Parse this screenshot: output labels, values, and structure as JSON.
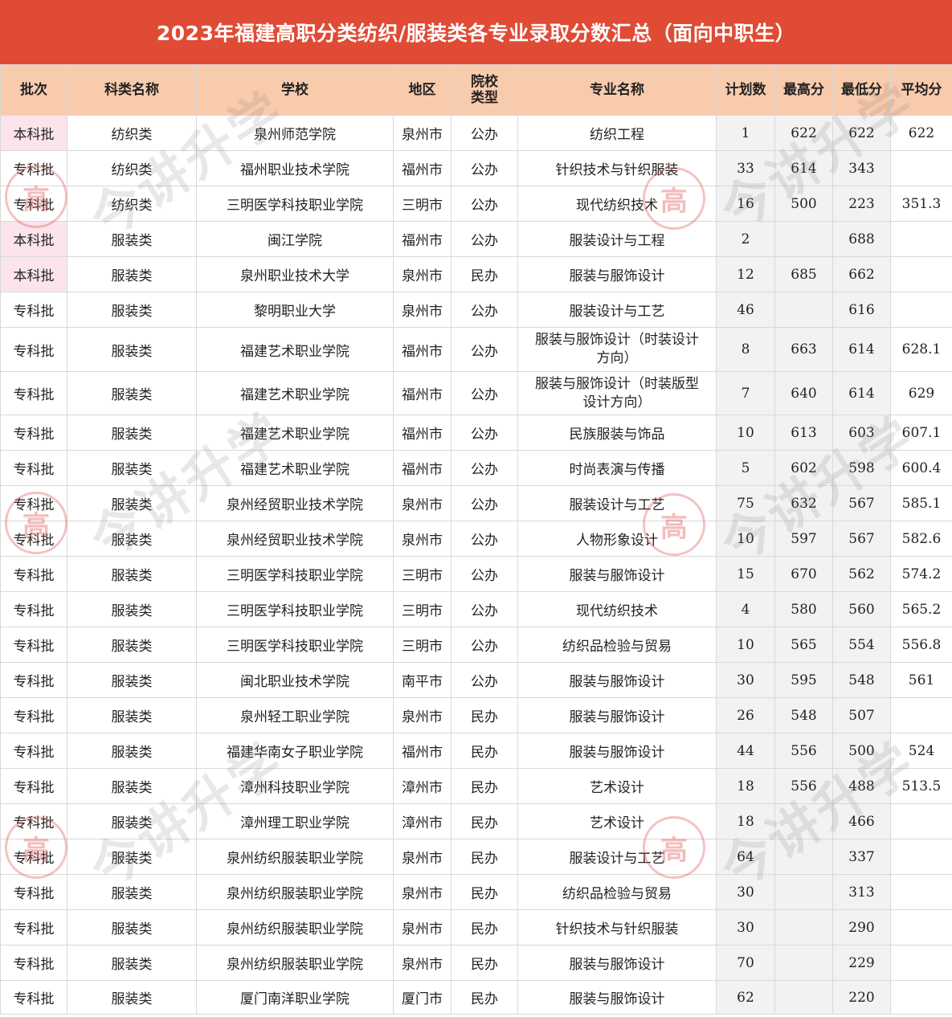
{
  "title": "2023年福建高职分类纺织/服装类各专业录取分数汇总（面向中职生）",
  "headers": [
    "批次",
    "科类名称",
    "学校",
    "地区",
    "院校类型",
    "专业名称",
    "计划数",
    "最高分",
    "最低分",
    "平均分"
  ],
  "header_school_type": [
    "院校",
    "类型"
  ],
  "watermark_text": "今讲升学",
  "seal_char": "高",
  "rows": [
    {
      "batch": "本科批",
      "category": "纺织类",
      "school": "泉州师范学院",
      "region": "泉州市",
      "type": "公办",
      "major": "纺织工程",
      "plan": "1",
      "max": "622",
      "min": "622",
      "avg": "622"
    },
    {
      "batch": "专科批",
      "category": "纺织类",
      "school": "福州职业技术学院",
      "region": "福州市",
      "type": "公办",
      "major": "针织技术与针织服装",
      "plan": "33",
      "max": "614",
      "min": "343",
      "avg": ""
    },
    {
      "batch": "专科批",
      "category": "纺织类",
      "school": "三明医学科技职业学院",
      "region": "三明市",
      "type": "公办",
      "major": "现代纺织技术",
      "plan": "16",
      "max": "500",
      "min": "223",
      "avg": "351.3"
    },
    {
      "batch": "本科批",
      "category": "服装类",
      "school": "闽江学院",
      "region": "福州市",
      "type": "公办",
      "major": "服装设计与工程",
      "plan": "2",
      "max": "",
      "min": "688",
      "avg": ""
    },
    {
      "batch": "本科批",
      "category": "服装类",
      "school": "泉州职业技术大学",
      "region": "泉州市",
      "type": "民办",
      "major": "服装与服饰设计",
      "plan": "12",
      "max": "685",
      "min": "662",
      "avg": ""
    },
    {
      "batch": "专科批",
      "category": "服装类",
      "school": "黎明职业大学",
      "region": "泉州市",
      "type": "公办",
      "major": "服装设计与工艺",
      "plan": "46",
      "max": "",
      "min": "616",
      "avg": ""
    },
    {
      "batch": "专科批",
      "category": "服装类",
      "school": "福建艺术职业学院",
      "region": "福州市",
      "type": "公办",
      "major": "服装与服饰设计（时装设计方向）",
      "major_l1": "服装与服饰设计（时装设计",
      "major_l2": "方向）",
      "plan": "8",
      "max": "663",
      "min": "614",
      "avg": "628.1"
    },
    {
      "batch": "专科批",
      "category": "服装类",
      "school": "福建艺术职业学院",
      "region": "福州市",
      "type": "公办",
      "major": "服装与服饰设计（时装版型设计方向）",
      "major_l1": "服装与服饰设计（时装版型",
      "major_l2": "设计方向）",
      "plan": "7",
      "max": "640",
      "min": "614",
      "avg": "629"
    },
    {
      "batch": "专科批",
      "category": "服装类",
      "school": "福建艺术职业学院",
      "region": "福州市",
      "type": "公办",
      "major": "民族服装与饰品",
      "plan": "10",
      "max": "613",
      "min": "603",
      "avg": "607.1"
    },
    {
      "batch": "专科批",
      "category": "服装类",
      "school": "福建艺术职业学院",
      "region": "福州市",
      "type": "公办",
      "major": "时尚表演与传播",
      "plan": "5",
      "max": "602",
      "min": "598",
      "avg": "600.4"
    },
    {
      "batch": "专科批",
      "category": "服装类",
      "school": "泉州经贸职业技术学院",
      "region": "泉州市",
      "type": "公办",
      "major": "服装设计与工艺",
      "plan": "75",
      "max": "632",
      "min": "567",
      "avg": "585.1"
    },
    {
      "batch": "专科批",
      "category": "服装类",
      "school": "泉州经贸职业技术学院",
      "region": "泉州市",
      "type": "公办",
      "major": "人物形象设计",
      "plan": "10",
      "max": "597",
      "min": "567",
      "avg": "582.6"
    },
    {
      "batch": "专科批",
      "category": "服装类",
      "school": "三明医学科技职业学院",
      "region": "三明市",
      "type": "公办",
      "major": "服装与服饰设计",
      "plan": "15",
      "max": "670",
      "min": "562",
      "avg": "574.2"
    },
    {
      "batch": "专科批",
      "category": "服装类",
      "school": "三明医学科技职业学院",
      "region": "三明市",
      "type": "公办",
      "major": "现代纺织技术",
      "plan": "4",
      "max": "580",
      "min": "560",
      "avg": "565.2"
    },
    {
      "batch": "专科批",
      "category": "服装类",
      "school": "三明医学科技职业学院",
      "region": "三明市",
      "type": "公办",
      "major": "纺织品检验与贸易",
      "plan": "10",
      "max": "565",
      "min": "554",
      "avg": "556.8"
    },
    {
      "batch": "专科批",
      "category": "服装类",
      "school": "闽北职业技术学院",
      "region": "南平市",
      "type": "公办",
      "major": "服装与服饰设计",
      "plan": "30",
      "max": "595",
      "min": "548",
      "avg": "561"
    },
    {
      "batch": "专科批",
      "category": "服装类",
      "school": "泉州轻工职业学院",
      "region": "泉州市",
      "type": "民办",
      "major": "服装与服饰设计",
      "plan": "26",
      "max": "548",
      "min": "507",
      "avg": ""
    },
    {
      "batch": "专科批",
      "category": "服装类",
      "school": "福建华南女子职业学院",
      "region": "福州市",
      "type": "民办",
      "major": "服装与服饰设计",
      "plan": "44",
      "max": "556",
      "min": "500",
      "avg": "524"
    },
    {
      "batch": "专科批",
      "category": "服装类",
      "school": "漳州科技职业学院",
      "region": "漳州市",
      "type": "民办",
      "major": "艺术设计",
      "plan": "18",
      "max": "556",
      "min": "488",
      "avg": "513.5"
    },
    {
      "batch": "专科批",
      "category": "服装类",
      "school": "漳州理工职业学院",
      "region": "漳州市",
      "type": "民办",
      "major": "艺术设计",
      "plan": "18",
      "max": "",
      "min": "466",
      "avg": ""
    },
    {
      "batch": "专科批",
      "category": "服装类",
      "school": "泉州纺织服装职业学院",
      "region": "泉州市",
      "type": "民办",
      "major": "服装设计与工艺",
      "plan": "64",
      "max": "",
      "min": "337",
      "avg": ""
    },
    {
      "batch": "专科批",
      "category": "服装类",
      "school": "泉州纺织服装职业学院",
      "region": "泉州市",
      "type": "民办",
      "major": "纺织品检验与贸易",
      "plan": "30",
      "max": "",
      "min": "313",
      "avg": ""
    },
    {
      "batch": "专科批",
      "category": "服装类",
      "school": "泉州纺织服装职业学院",
      "region": "泉州市",
      "type": "民办",
      "major": "针织技术与针织服装",
      "plan": "30",
      "max": "",
      "min": "290",
      "avg": ""
    },
    {
      "batch": "专科批",
      "category": "服装类",
      "school": "泉州纺织服装职业学院",
      "region": "泉州市",
      "type": "民办",
      "major": "服装与服饰设计",
      "plan": "70",
      "max": "",
      "min": "229",
      "avg": ""
    },
    {
      "batch": "专科批",
      "category": "服装类",
      "school": "厦门南洋职业学院",
      "region": "厦门市",
      "type": "民办",
      "major": "服装与服饰设计",
      "plan": "62",
      "max": "",
      "min": "220",
      "avg": ""
    }
  ]
}
